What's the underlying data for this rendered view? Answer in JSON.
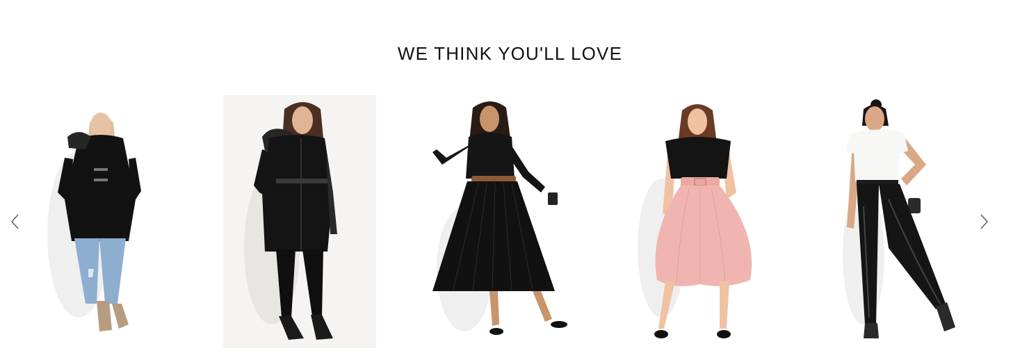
{
  "section": {
    "title": "WE THINK YOU'LL LOVE"
  },
  "carousel": {
    "prev_icon": "chevron-left-icon",
    "next_icon": "chevron-right-icon",
    "arrow_color": "#555555"
  },
  "products": [
    {
      "name": "",
      "outfit": "black hooded duffle coat with faux fur trim, ripped blue jeans, tan ankle boots"
    },
    {
      "name": "",
      "outfit": "black fur-hood coat with belt, black skinny pants, black heeled sandals"
    },
    {
      "name": "",
      "outfit": "black pleated midi dress with brown belt, black sandals"
    },
    {
      "name": "",
      "outfit": "black tee with pink belted full skirt, black t-bar heels"
    },
    {
      "name": "",
      "outfit": "white cap-sleeve top, black faux leather skinny pants, studded heels"
    }
  ],
  "colors": {
    "title": "#111111",
    "pink_skirt": "#f0b5b0",
    "denim": "#8eaed0",
    "belt_brown": "#8a5a36",
    "image_frame": "#f5f4f2"
  }
}
